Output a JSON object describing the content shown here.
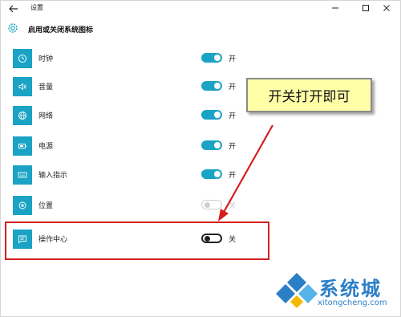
{
  "window": {
    "title": "设置",
    "controls": {
      "minimize": "—",
      "maximize": "☐",
      "close": "✕"
    }
  },
  "page": {
    "title": "启用或关闭系统图标"
  },
  "items": [
    {
      "label": "时钟",
      "state": "开",
      "on": true,
      "icon": "clock-icon"
    },
    {
      "label": "音量",
      "state": "开",
      "on": true,
      "icon": "volume-icon"
    },
    {
      "label": "网络",
      "state": "开",
      "on": true,
      "icon": "globe-icon"
    },
    {
      "label": "电源",
      "state": "开",
      "on": true,
      "icon": "battery-icon"
    },
    {
      "label": "输入指示",
      "state": "开",
      "on": true,
      "icon": "keyboard-icon"
    },
    {
      "label": "位置",
      "state": "关",
      "on": false,
      "disabled": true,
      "icon": "location-icon"
    },
    {
      "label": "操作中心",
      "state": "关",
      "on": false,
      "icon": "action-center-icon"
    }
  ],
  "annotation": {
    "callout_text": "开关打开即可",
    "highlight_color": "#d61e1e",
    "callout_bg": "#ffffa8"
  },
  "watermark": {
    "name": "系统城",
    "url": "xitongcheng.com"
  },
  "colors": {
    "accent": "#1aa3c4"
  }
}
